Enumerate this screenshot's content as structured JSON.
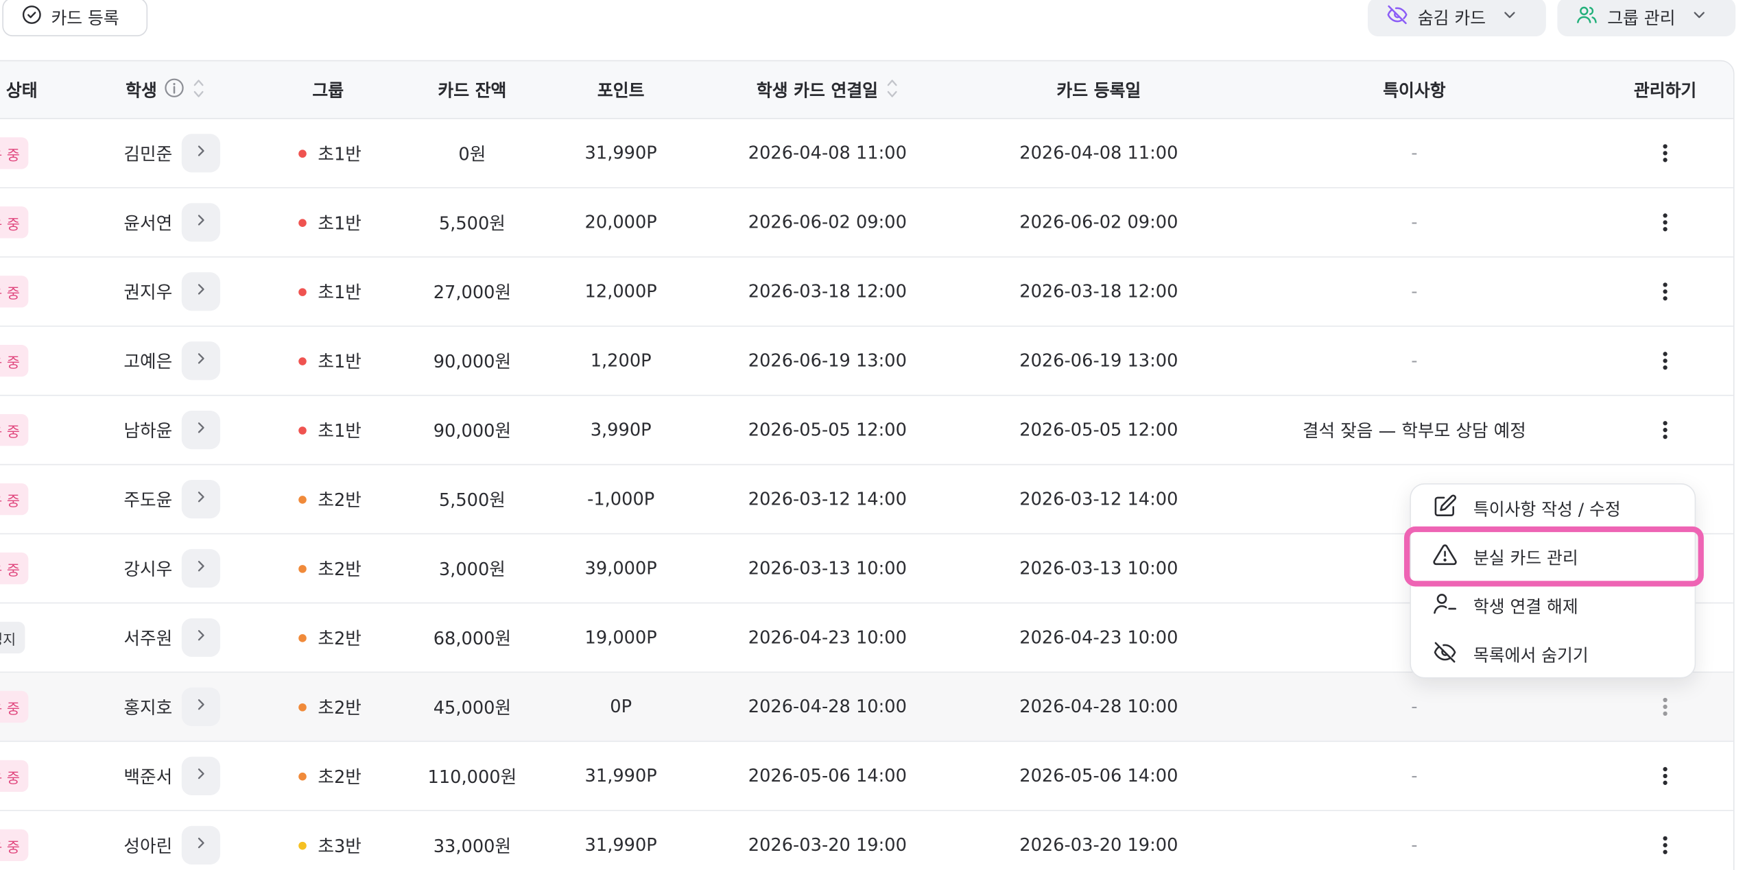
{
  "toolbar": {
    "register_label": "카드 등록",
    "hidden_cards_label": "숨김 카드",
    "group_manage_label": "그룹 관리"
  },
  "table": {
    "headers": {
      "status": "상태",
      "student": "학생",
      "group": "그룹",
      "balance": "카드 잔액",
      "points": "포인트",
      "linked_at": "학생 카드 연결일",
      "registered_at": "카드 등록일",
      "notes": "특이사항",
      "manage": "관리하기"
    },
    "rows": [
      {
        "status": "사용 중",
        "name": "김민준",
        "group": "초1반",
        "balance": "0원",
        "points": "31,990P",
        "linked": "2026-04-08 11:00",
        "registered": "2026-04-08 11:00",
        "note": "-"
      },
      {
        "status": "사용 중",
        "name": "윤서연",
        "group": "초1반",
        "balance": "5,500원",
        "points": "20,000P",
        "linked": "2026-06-02 09:00",
        "registered": "2026-06-02 09:00",
        "note": "-"
      },
      {
        "status": "사용 중",
        "name": "권지우",
        "group": "초1반",
        "balance": "27,000원",
        "points": "12,000P",
        "linked": "2026-03-18 12:00",
        "registered": "2026-03-18 12:00",
        "note": "-"
      },
      {
        "status": "사용 중",
        "name": "고예은",
        "group": "초1반",
        "balance": "90,000원",
        "points": "1,200P",
        "linked": "2026-06-19 13:00",
        "registered": "2026-06-19 13:00",
        "note": "-"
      },
      {
        "status": "사용 중",
        "name": "남하윤",
        "group": "초1반",
        "balance": "90,000원",
        "points": "3,990P",
        "linked": "2026-05-05 12:00",
        "registered": "2026-05-05 12:00",
        "note": "결석 잦음 — 학부모 상담 예정"
      },
      {
        "status": "사용 중",
        "name": "주도윤",
        "group": "초2반",
        "balance": "5,500원",
        "points": "-1,000P",
        "linked": "2026-03-12 14:00",
        "registered": "2026-03-12 14:00",
        "note": ""
      },
      {
        "status": "사용 중",
        "name": "강시우",
        "group": "초2반",
        "balance": "3,000원",
        "points": "39,000P",
        "linked": "2026-03-13 10:00",
        "registered": "2026-03-13 10:00",
        "note": ""
      },
      {
        "status": "정지",
        "name": "서주원",
        "group": "초2반",
        "balance": "68,000원",
        "points": "19,000P",
        "linked": "2026-04-23 10:00",
        "registered": "2026-04-23 10:00",
        "note": ""
      },
      {
        "status": "사용 중",
        "name": "홍지호",
        "group": "초2반",
        "balance": "45,000원",
        "points": "0P",
        "linked": "2026-04-28 10:00",
        "registered": "2026-04-28 10:00",
        "note": "-"
      },
      {
        "status": "사용 중",
        "name": "백준서",
        "group": "초2반",
        "balance": "110,000원",
        "points": "31,990P",
        "linked": "2026-05-06 14:00",
        "registered": "2026-05-06 14:00",
        "note": "-"
      },
      {
        "status": "사용 중",
        "name": "성아린",
        "group": "초3반",
        "balance": "33,000원",
        "points": "31,990P",
        "linked": "2026-03-20 19:00",
        "registered": "2026-03-20 19:00",
        "note": "-"
      }
    ]
  },
  "group_colors": {
    "초1반": "#ef5350",
    "초2반": "#f08a3a",
    "초3반": "#f5c022"
  },
  "menu": {
    "items": [
      {
        "label": "특이사항 작성 / 수정",
        "icon": "edit-icon"
      },
      {
        "label": "분실 카드 관리",
        "icon": "warning-icon"
      },
      {
        "label": "학생 연결 해제",
        "icon": "user-minus-icon"
      },
      {
        "label": "목록에서 숨기기",
        "icon": "eye-off-icon"
      }
    ],
    "highlighted_index": 1
  },
  "colors": {
    "accent_pink": "#e0467d",
    "highlight_border": "#ee64b4",
    "hidden_icon": "#8b5cf6",
    "group_icon": "#22b07a"
  }
}
